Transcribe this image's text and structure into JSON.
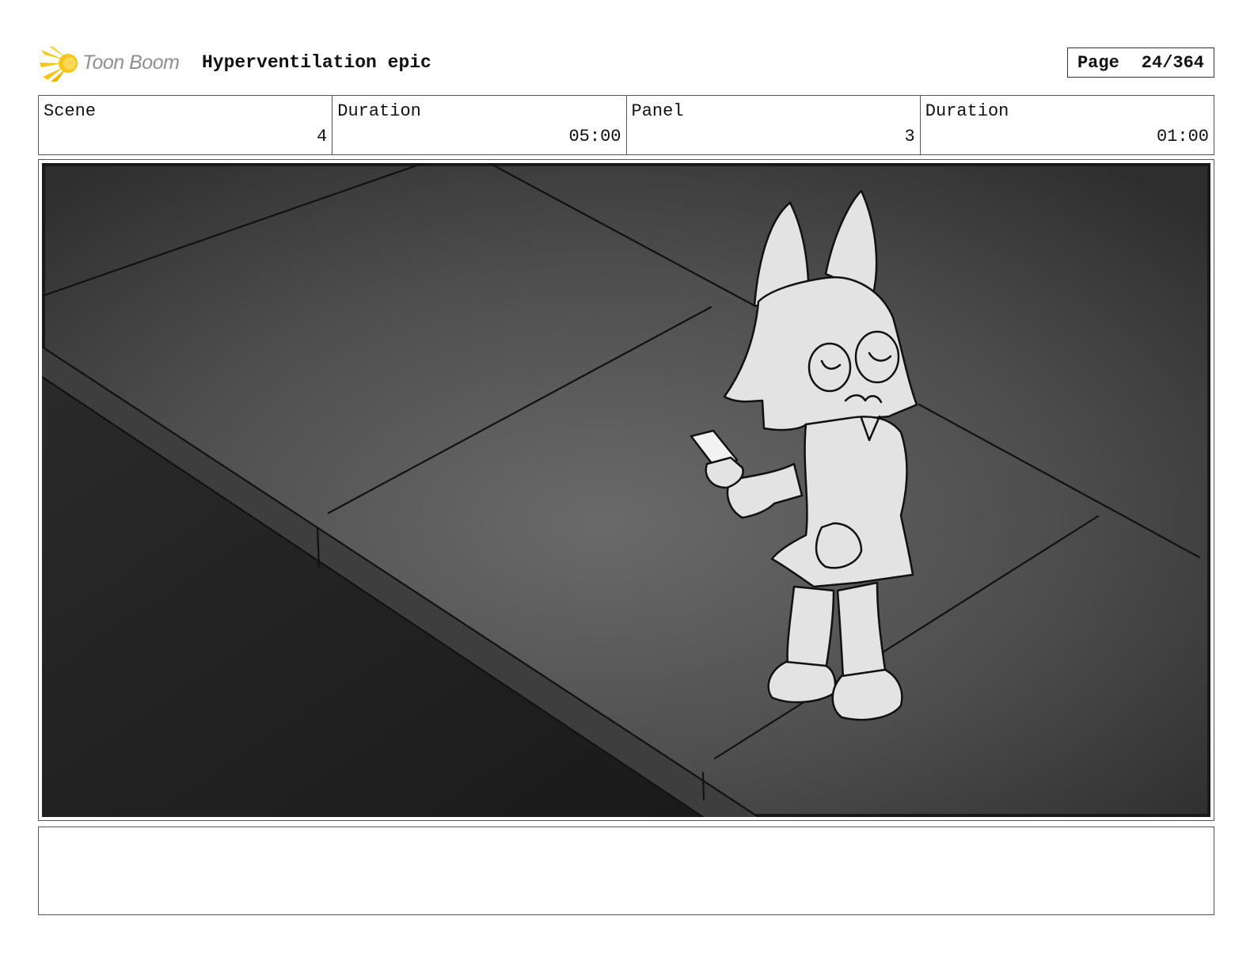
{
  "header": {
    "logo_text": "Toon Boom",
    "title": "Hyperventilation epic",
    "page_label": "Page",
    "page_value": "24/364"
  },
  "info": {
    "scene_label": "Scene",
    "scene_value": "4",
    "scene_duration_label": "Duration",
    "scene_duration_value": "05:00",
    "panel_label": "Panel",
    "panel_value": "3",
    "panel_duration_label": "Duration",
    "panel_duration_value": "01:00"
  },
  "notes": {
    "text": ""
  },
  "colors": {
    "logo_yellow": "#f5c518",
    "logo_gray": "#8f8f8f",
    "panel_bg": "#4a4a4a",
    "panel_dark": "#222222",
    "character_fill": "#e3e3e3",
    "line": "#111111"
  },
  "icons": {
    "logo": "toon-boom-starburst-icon"
  }
}
